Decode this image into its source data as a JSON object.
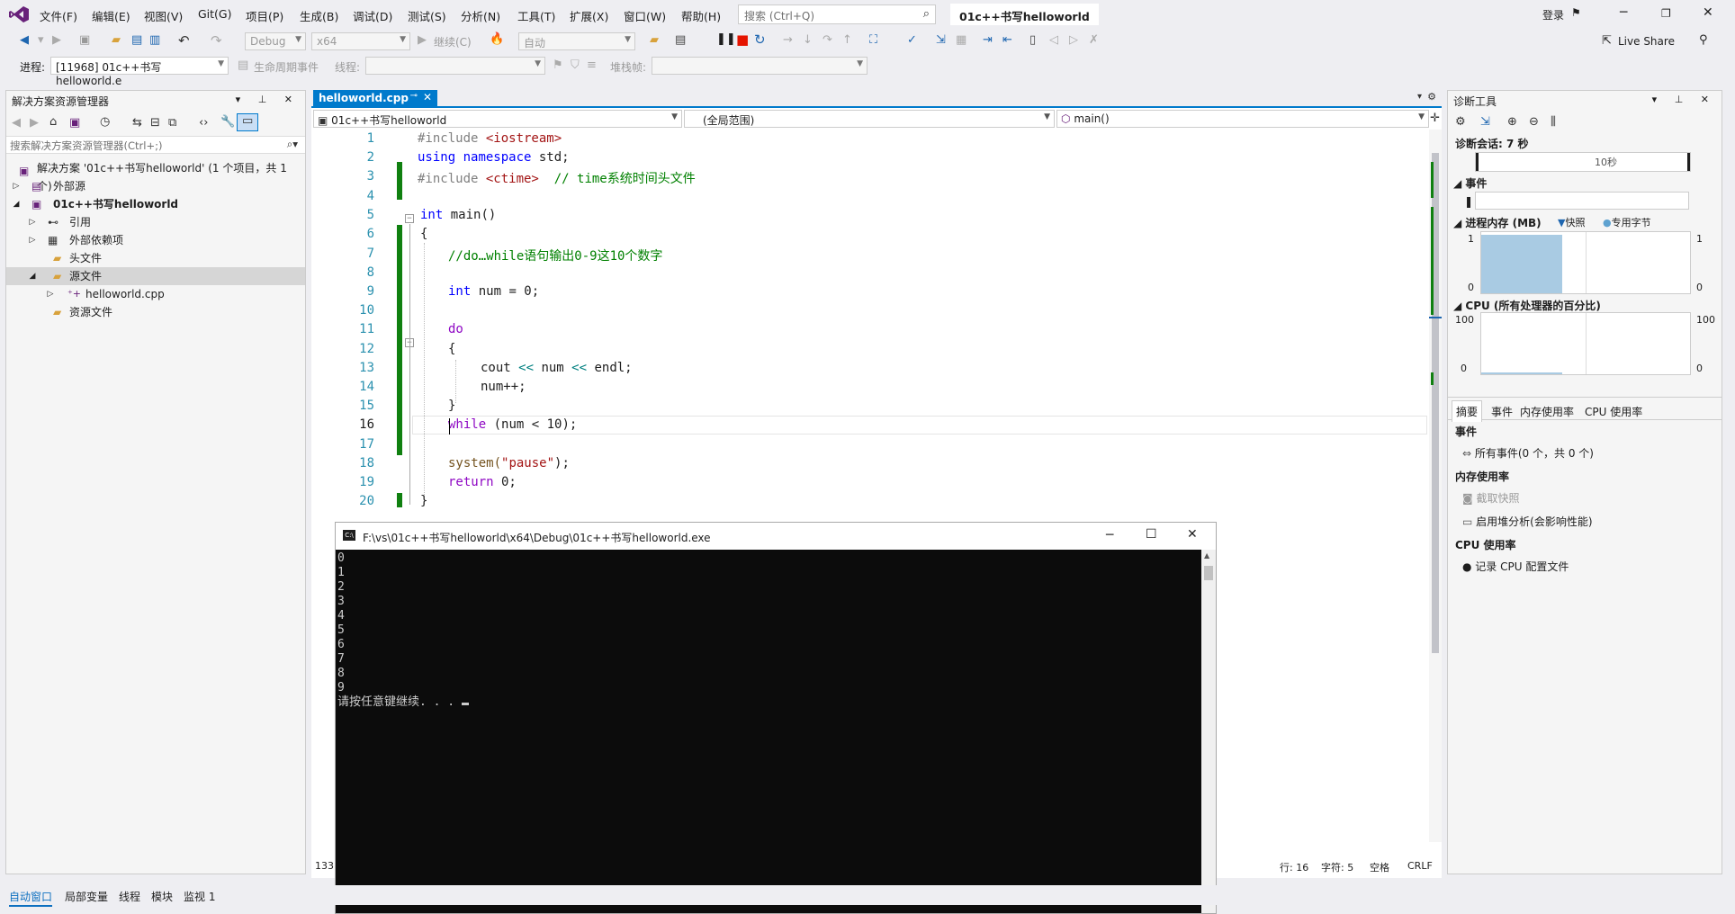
{
  "titlebar": {
    "menus": [
      "文件(F)",
      "编辑(E)",
      "视图(V)",
      "Git(G)",
      "项目(P)",
      "生成(B)",
      "调试(D)",
      "测试(S)",
      "分析(N)",
      "工具(T)",
      "扩展(X)",
      "窗口(W)",
      "帮助(H)"
    ],
    "search_placeholder": "搜索 (Ctrl+Q)",
    "solution_name": "01c++书写helloworld",
    "signin": "登录",
    "live_share": "Live Share"
  },
  "toolbar": {
    "config": "Debug",
    "platform": "x64",
    "continue_label": "继续(C)",
    "auto_label": "自动"
  },
  "debugbar": {
    "process_label": "进程:",
    "process_value": "[11968] 01c++书写helloworld.e",
    "lifecycle_label": "生命周期事件",
    "thread_label": "线程:",
    "stackframe_label": "堆栈帧:"
  },
  "solution_explorer": {
    "title": "解决方案资源管理器",
    "search_placeholder": "搜索解决方案资源管理器(Ctrl+;)",
    "items": [
      {
        "label": "解决方案 '01c++书写helloworld' (1 个项目，共 1 个)",
        "bold": false
      },
      {
        "label": "外部源",
        "bold": false
      },
      {
        "label": "01c++书写helloworld",
        "bold": true
      },
      {
        "label": "引用",
        "bold": false
      },
      {
        "label": "外部依赖项",
        "bold": false
      },
      {
        "label": "头文件",
        "bold": false
      },
      {
        "label": "源文件",
        "bold": false
      },
      {
        "label": "helloworld.cpp",
        "bold": false
      },
      {
        "label": "资源文件",
        "bold": false
      }
    ]
  },
  "editor": {
    "tab_label": "helloworld.cpp",
    "nav_project": "01c++书写helloworld",
    "nav_scope": "(全局范围)",
    "nav_member": "main()",
    "lines": [
      "1",
      "2",
      "3",
      "4",
      "5",
      "6",
      "7",
      "8",
      "9",
      "10",
      "11",
      "12",
      "13",
      "14",
      "15",
      "16",
      "17",
      "18",
      "19",
      "20"
    ],
    "code": {
      "l1_pp": "#include ",
      "l1_inc": "<iostream>",
      "l2_kw1": "using",
      "l2_kw2": "namespace",
      "l2_rest": " std;",
      "l3_pp": "#include ",
      "l3_inc": "<ctime>",
      "l3_cm": "  // time系统时间头文件",
      "l5_kw": "int",
      "l5_rest": " main()",
      "l6": "{",
      "l7_cm": "//do…while语句输出0-9这10个数字",
      "l9_kw": "int",
      "l9_rest": " num = 0;",
      "l11_kw": "do",
      "l12": "{",
      "l13_a": "cout ",
      "l13_op1": "<<",
      "l13_b": " num ",
      "l13_op2": "<<",
      "l13_c": " endl;",
      "l14": "num++;",
      "l15": "}",
      "l16_kw": "while",
      "l16_rest": " (num < 10);",
      "l18_fn": "system(",
      "l18_str": "\"pause\"",
      "l18_end": ");",
      "l19_kw": "return",
      "l19_rest": " 0;",
      "l20": "}"
    },
    "zoom": "133 %",
    "status_line": "行: 16",
    "status_char": "字符: 5",
    "status_space": "空格",
    "status_crlf": "CRLF"
  },
  "console": {
    "title": "F:\\vs\\01c++书写helloworld\\x64\\Debug\\01c++书写helloworld.exe",
    "output": "0\n1\n2\n3\n4\n5\n6\n7\n8\n9\n请按任意键继续. . . "
  },
  "diagnostics": {
    "title": "诊断工具",
    "session": "诊断会话: 7 秒",
    "timeline_tick": "10秒",
    "events_label": "事件",
    "memory_label": "进程内存 (MB)",
    "snapshot_legend": "快照",
    "private_bytes_legend": "专用字节",
    "mem_max": "1",
    "mem_min": "0",
    "cpu_label": "CPU (所有处理器的百分比)",
    "cpu_max": "100",
    "cpu_min": "0",
    "tabs": [
      "摘要",
      "事件",
      "内存使用率",
      "CPU 使用率"
    ],
    "sec_events": "事件",
    "all_events": "所有事件(0 个，共 0 个)",
    "sec_memory": "内存使用率",
    "take_snapshot": "截取快照",
    "heap_analysis": "启用堆分析(会影响性能)",
    "sec_cpu": "CPU 使用率",
    "record_cpu": "记录 CPU 配置文件",
    "mem_fill": 0.95
  },
  "bottom": {
    "tabs": [
      "自动窗口",
      "局部变量",
      "线程",
      "模块",
      "监视 1"
    ]
  },
  "colors": {
    "accent": "#007acc",
    "change_bar": "#108010",
    "vs_purple": "#68217a"
  }
}
